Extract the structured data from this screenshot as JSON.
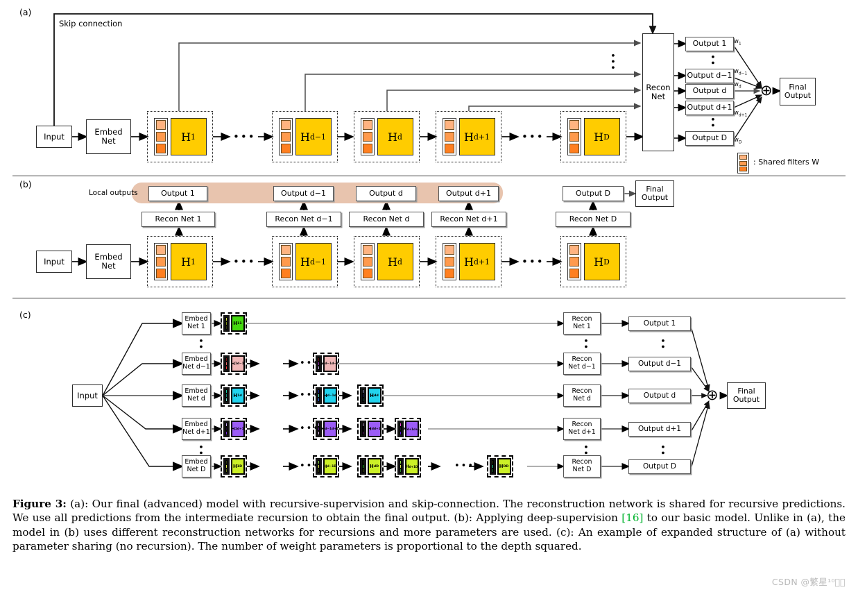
{
  "figure": {
    "number": "Figure 3:",
    "caption_text": " (a): Our final (advanced) model with recursive-supervision and skip-connection. The reconstruction network is shared for recursive predictions. We use all predictions from the intermediate recursion to obtain the final output. (b): Applying deep-supervision ",
    "citation": "[16]",
    "caption_text2": " to our basic model. Unlike in (a), the model in (b) uses different reconstruction networks for recursions and more parameters are used. (c): An example of expanded structure of (a) without parameter sharing (no recursion). The number of weight parameters is proportional to the depth squared.",
    "watermark": "CSDN @繁星¹⁰⃞⃞"
  },
  "colors": {
    "gold": "#FFCC00",
    "salmon_band": "#E8C4AE",
    "filter_light": "#FFB380",
    "filter_mid": "#FF9A4D",
    "filter_dark": "#FF7F20",
    "green": "#45D910",
    "pink": "#F0B8B8",
    "cyan": "#22D3EE",
    "purple": "#9B5CF6",
    "yellowgreen": "#CCF027",
    "citation_green": "#00B32D"
  },
  "panel_a": {
    "label": "(a)",
    "skip_connection_label": "Skip connection",
    "input": "Input",
    "embed_net": "Embed\nNet",
    "recon_net": "Recon\nNet",
    "final_output": "Final\nOutput",
    "legend": ": Shared filters W",
    "hidden_blocks": [
      {
        "label": "H",
        "sub": "1"
      },
      {
        "label": "H",
        "sub": "d−1"
      },
      {
        "label": "H",
        "sub": "d"
      },
      {
        "label": "H",
        "sub": "d+1"
      },
      {
        "label": "H",
        "sub": "D"
      }
    ],
    "outputs": [
      {
        "label": "Output 1",
        "weight": "w",
        "weight_sub": "1"
      },
      {
        "label": "Output d−1",
        "weight": "w",
        "weight_sub": "d−1"
      },
      {
        "label": "Output d",
        "weight": "w",
        "weight_sub": "d"
      },
      {
        "label": "Output d+1",
        "weight": "w",
        "weight_sub": "d+1"
      },
      {
        "label": "Output D",
        "weight": "w",
        "weight_sub": "D"
      }
    ],
    "sum_symbol": "⊕"
  },
  "panel_b": {
    "label": "(b)",
    "local_outputs_label": "Local outputs",
    "input": "Input",
    "embed_net": "Embed\nNet",
    "final_output": "Final\nOutput",
    "hidden_blocks": [
      {
        "label": "H",
        "sub": "1"
      },
      {
        "label": "H",
        "sub": "d−1"
      },
      {
        "label": "H",
        "sub": "d"
      },
      {
        "label": "H",
        "sub": "d+1"
      },
      {
        "label": "H",
        "sub": "D"
      }
    ],
    "recon_nets": [
      "Recon Net 1",
      "Recon Net d−1",
      "Recon Net d",
      "Recon Net d+1",
      "Recon Net D"
    ],
    "outputs": [
      "Output 1",
      "Output d−1",
      "Output d",
      "Output d+1",
      "Output D"
    ]
  },
  "panel_c": {
    "label": "(c)",
    "input": "Input",
    "embed_nets": [
      "Embed\nNet 1",
      "Embed\nNet d−1",
      "Embed\nNet d",
      "Embed\nNet d+1",
      "Embed\nNet D"
    ],
    "recon_nets": [
      "Recon\nNet 1",
      "Recon\nNet d−1",
      "Recon\nNet d",
      "Recon\nNet d+1",
      "Recon\nNet D"
    ],
    "outputs": [
      "Output 1",
      "Output d−1",
      "Output d",
      "Output d+1",
      "Output D"
    ],
    "final_output": "Final\nOutput",
    "sum_symbol": "⊕",
    "rows": [
      {
        "superscript": "1",
        "color": "#45D910",
        "blocks": [
          {
            "sub": "1"
          }
        ]
      },
      {
        "superscript": "d−1",
        "color": "#F0B8B8",
        "blocks": [
          {
            "sub": "1"
          },
          {
            "sub": "d−1"
          }
        ]
      },
      {
        "superscript": "d",
        "color": "#22D3EE",
        "blocks": [
          {
            "sub": "1"
          },
          {
            "sub": "d−1"
          },
          {
            "sub": "d"
          }
        ]
      },
      {
        "superscript": "d+1",
        "color": "#9B5CF6",
        "blocks": [
          {
            "sub": "1"
          },
          {
            "sub": "d−1"
          },
          {
            "sub": "d"
          },
          {
            "sub": "d+1"
          }
        ]
      },
      {
        "superscript": "D",
        "color": "#CCF027",
        "blocks": [
          {
            "sub": "1"
          },
          {
            "sub": "d−1"
          },
          {
            "sub": "d"
          },
          {
            "sub": "d+1"
          },
          {
            "sub": "D"
          }
        ]
      }
    ]
  }
}
